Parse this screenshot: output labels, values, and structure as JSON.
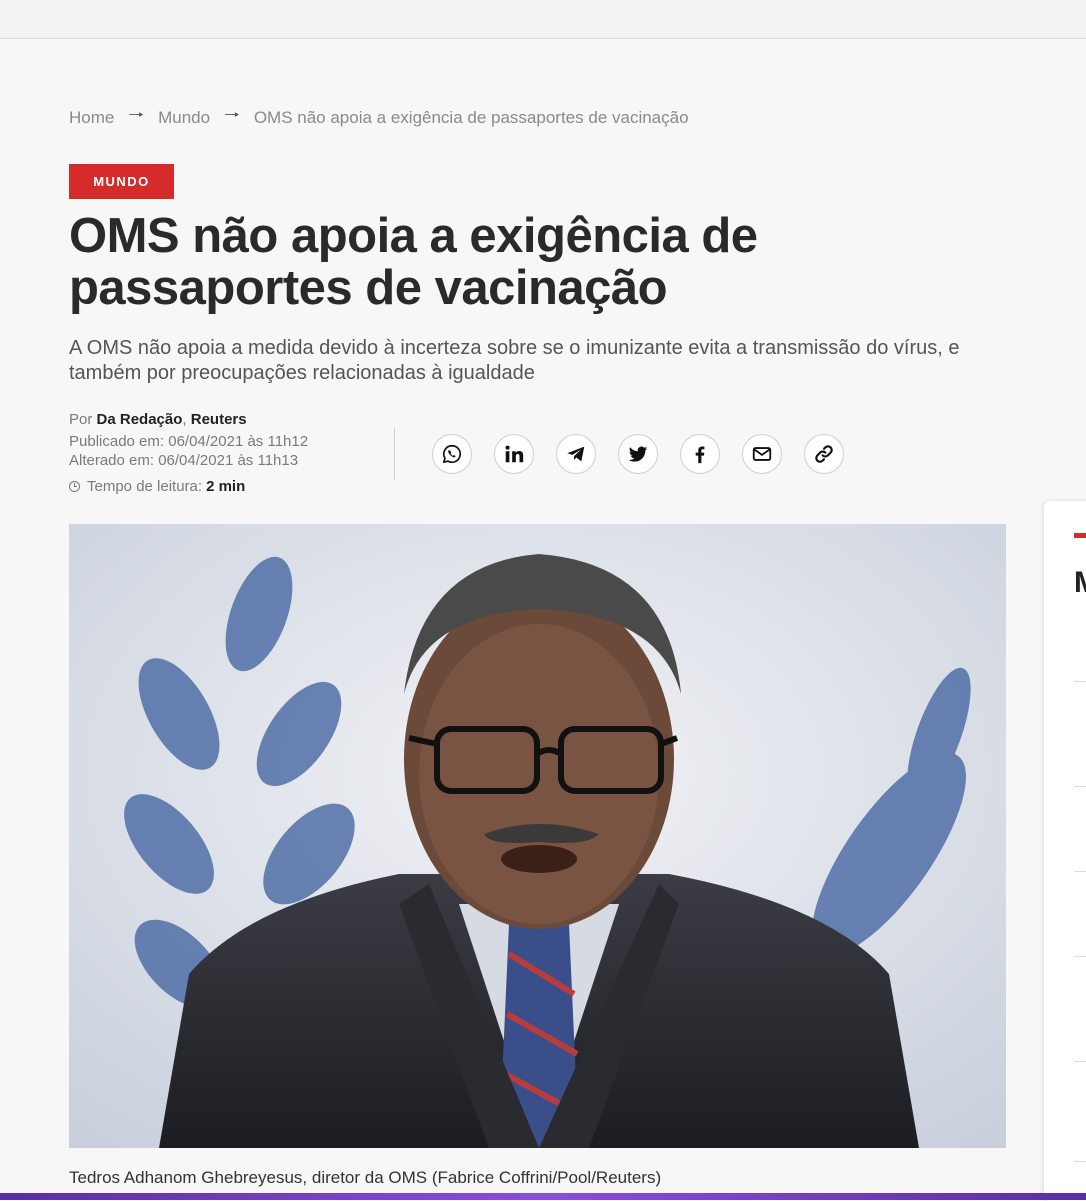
{
  "breadcrumb": {
    "home": "Home",
    "section": "Mundo",
    "current": "OMS não apoia a exigência de passaportes de vacinação",
    "separator": "🠒"
  },
  "article": {
    "category": "MUNDO",
    "title": "OMS não apoia a exigência de passaportes de vacinação",
    "subtitle": "A OMS não apoia a medida devido à incerteza sobre se o imunizante evita a transmissão do vírus, e também por preocupações relacionadas à igualdade",
    "byline": {
      "prefix": "Por",
      "author": "Da Redação",
      "comma": ",",
      "agency": "Reuters"
    },
    "published": "Publicado em: 06/04/2021 às 11h12",
    "updated": "Alterado em: 06/04/2021 às 11h13",
    "reading_time_label": "Tempo de leitura:",
    "reading_time": "2 min",
    "photo_caption": "Tedros Adhanom Ghebreyesus, diretor da OMS (Fabrice Coffrini/Pool/Reuters)"
  },
  "share": [
    "whatsapp-icon",
    "linkedin-icon",
    "telegram-icon",
    "twitter-icon",
    "facebook-icon",
    "email-icon",
    "link-icon"
  ],
  "sidebar": {
    "initial": "M"
  },
  "colors": {
    "accent": "#d52b2b",
    "text": "#2a2a2a",
    "muted": "#7a7a7a"
  }
}
